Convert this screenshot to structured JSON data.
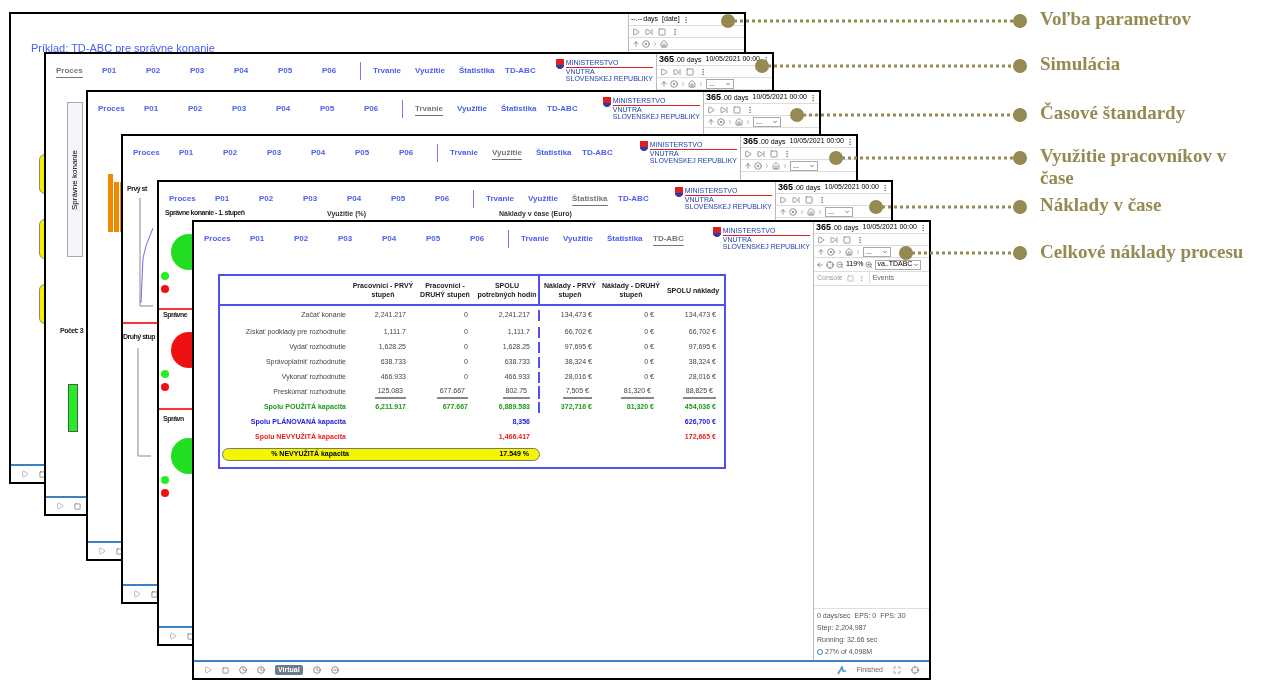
{
  "windows": [
    {
      "kind": "title",
      "title": "Príklad: TD-ABC pre správne konanie",
      "panel": {
        "time_value": "--.--",
        "time_unit": "days",
        "date": "[date]"
      },
      "content": [
        {
          "kind": "blob"
        },
        {
          "kind": "blob"
        },
        {
          "kind": "blob"
        }
      ]
    },
    {
      "kind": "nav",
      "nav_left": [
        {
          "label": "Proces",
          "selected": true
        },
        {
          "label": "P01",
          "selected": false
        },
        {
          "label": "P02",
          "selected": false
        },
        {
          "label": "P03",
          "selected": false
        },
        {
          "label": "P04",
          "selected": false
        },
        {
          "label": "P05",
          "selected": false
        },
        {
          "label": "P06",
          "selected": false
        }
      ],
      "nav_right": [
        {
          "label": "Trvanie",
          "selected": false
        },
        {
          "label": "Využitie",
          "selected": false
        },
        {
          "label": "Štatistika",
          "selected": false
        },
        {
          "label": "TD-ABC",
          "selected": false
        }
      ],
      "logo": [
        "MINISTERSTVO",
        "VNÚTRA",
        "SLOVENSKEJ REPUBLIKY"
      ],
      "panel": {
        "time_value": "365",
        "time_unit": ".00 days",
        "date": "10/05/2021 00:00",
        "select": "..."
      },
      "content": [
        {
          "kind": "vlabel",
          "text": "Správne konanie"
        },
        {
          "kind": "text",
          "text": "Počet: 3"
        },
        {
          "kind": "greenbar"
        }
      ]
    },
    {
      "kind": "nav",
      "nav_left": [
        {
          "label": "Proces",
          "selected": false
        },
        {
          "label": "P01",
          "selected": false
        },
        {
          "label": "P02",
          "selected": false
        },
        {
          "label": "P03",
          "selected": false
        },
        {
          "label": "P04",
          "selected": false
        },
        {
          "label": "P05",
          "selected": false
        },
        {
          "label": "P06",
          "selected": false
        }
      ],
      "nav_right": [
        {
          "label": "Trvanie",
          "selected": true
        },
        {
          "label": "Využitie",
          "selected": false
        },
        {
          "label": "Štatistika",
          "selected": false
        },
        {
          "label": "TD-ABC",
          "selected": false
        }
      ],
      "logo": [
        "MINISTERSTVO",
        "VNÚTRA",
        "SLOVENSKEJ REPUBLIKY"
      ],
      "panel": {
        "time_value": "365",
        "time_unit": ".00 days",
        "date": "10/05/2021 00:00",
        "select": "..."
      },
      "content": [
        {
          "kind": "bars"
        }
      ]
    },
    {
      "kind": "nav",
      "nav_left": [
        {
          "label": "Proces",
          "selected": false
        },
        {
          "label": "P01",
          "selected": false
        },
        {
          "label": "P02",
          "selected": false
        },
        {
          "label": "P03",
          "selected": false
        },
        {
          "label": "P04",
          "selected": false
        },
        {
          "label": "P05",
          "selected": false
        },
        {
          "label": "P06",
          "selected": false
        }
      ],
      "nav_right": [
        {
          "label": "Trvanie",
          "selected": false
        },
        {
          "label": "Využitie",
          "selected": true
        },
        {
          "label": "Štatistika",
          "selected": false
        },
        {
          "label": "TD-ABC",
          "selected": false
        }
      ],
      "logo": [
        "MINISTERSTVO",
        "VNÚTRA",
        "SLOVENSKEJ REPUBLIKY"
      ],
      "panel": {
        "time_value": "365",
        "time_unit": ".00 days",
        "date": "10/05/2021 00:00",
        "select": "..."
      },
      "content": [
        {
          "kind": "text",
          "text": "Prvý st"
        },
        {
          "kind": "line"
        },
        {
          "kind": "rule"
        },
        {
          "kind": "text",
          "text": "Druhý stup"
        },
        {
          "kind": "axes"
        }
      ]
    },
    {
      "kind": "nav",
      "nav_left": [
        {
          "label": "Proces",
          "selected": false
        },
        {
          "label": "P01",
          "selected": false
        },
        {
          "label": "P02",
          "selected": false
        },
        {
          "label": "P03",
          "selected": false
        },
        {
          "label": "P04",
          "selected": false
        },
        {
          "label": "P05",
          "selected": false
        },
        {
          "label": "P06",
          "selected": false
        }
      ],
      "nav_right": [
        {
          "label": "Trvanie",
          "selected": false
        },
        {
          "label": "Využitie",
          "selected": false
        },
        {
          "label": "Štatistika",
          "selected": true
        },
        {
          "label": "TD-ABC",
          "selected": false
        }
      ],
      "logo": [
        "MINISTERSTVO",
        "VNÚTRA",
        "SLOVENSKEJ REPUBLIKY"
      ],
      "panel": {
        "time_value": "365",
        "time_unit": ".00 days",
        "date": "10/05/2021 00:00",
        "select": "..."
      },
      "content": [
        {
          "kind": "text",
          "text": "Správne konanie - 1. stupeň"
        },
        {
          "kind": "small",
          "text": "Využitie (%)"
        },
        {
          "kind": "small",
          "text": "Náklady v čase (Euro)"
        },
        {
          "kind": "pie",
          "color": "#22dd22"
        },
        {
          "kind": "rule"
        },
        {
          "kind": "text",
          "text": "Správne"
        },
        {
          "kind": "pie",
          "color": "#ee1111"
        },
        {
          "kind": "rule"
        },
        {
          "kind": "text",
          "text": "Správn"
        },
        {
          "kind": "pie",
          "color": "#22dd22"
        }
      ]
    },
    {
      "kind": "front",
      "nav_left": [
        {
          "label": "Proces",
          "selected": false
        },
        {
          "label": "P01",
          "selected": false
        },
        {
          "label": "P02",
          "selected": false
        },
        {
          "label": "P03",
          "selected": false
        },
        {
          "label": "P04",
          "selected": false
        },
        {
          "label": "P05",
          "selected": false
        },
        {
          "label": "P06",
          "selected": false
        }
      ],
      "nav_right": [
        {
          "label": "Trvanie",
          "selected": false
        },
        {
          "label": "Využitie",
          "selected": false
        },
        {
          "label": "Štatistika",
          "selected": false
        },
        {
          "label": "TD-ABC",
          "selected": true
        }
      ],
      "logo": [
        "MINISTERSTVO",
        "VNÚTRA",
        "SLOVENSKEJ REPUBLIKY"
      ],
      "panel": {
        "time_value": "365",
        "time_unit": ".00 days",
        "date": "10/05/2021 00:00",
        "select": "...",
        "zoom": "119%",
        "view": "va..TDABC",
        "tabs": [
          "Console",
          "Events"
        ],
        "stats": [
          "0 days/sec",
          "EPS: 0",
          "FPS: 30",
          "Step: 2,204,987"
        ],
        "running": "Running: 32.66 sec",
        "memory": "27% of 4,098M"
      },
      "toolbar": {
        "mode": "Virtual",
        "status": "Finished"
      },
      "table": {
        "columns": [
          "Pracovníci - PRVÝ stupeň",
          "Pracovníci - DRUHÝ stupeň",
          "SPOLU potrebných hodín",
          "Náklady - PRVÝ stupeň",
          "Náklady - DRUHÝ stupeň",
          "SPOLU náklady"
        ],
        "rows": [
          {
            "kind": "item",
            "label": "Začať konanie",
            "values": [
              "2,241.217",
              "0",
              "2,241.217",
              "134,473 €",
              "0 €",
              "134,473 €"
            ]
          },
          {
            "kind": "item",
            "label": "Získať podklady pre rozhodnutie",
            "values": [
              "1,111.7",
              "0",
              "1,111.7",
              "66,702 €",
              "0 €",
              "66,702 €"
            ]
          },
          {
            "kind": "item",
            "label": "Vydať rozhodnutie",
            "values": [
              "1,628.25",
              "0",
              "1,628.25",
              "97,695 €",
              "0 €",
              "97,695 €"
            ]
          },
          {
            "kind": "item",
            "label": "Správoplatniť rozhodnutie",
            "values": [
              "638.733",
              "0",
              "638.733",
              "38,324 €",
              "0 €",
              "38,324 €"
            ]
          },
          {
            "kind": "item",
            "label": "Vykonať rozhodnutie",
            "values": [
              "466.933",
              "0",
              "466.933",
              "28,016 €",
              "0 €",
              "28,016 €"
            ]
          },
          {
            "kind": "last",
            "label": "Preskúmať rozhodnutie",
            "values": [
              "125.083",
              "677.667",
              "802.75",
              "7,505 €",
              "81,320 €",
              "88,825 €"
            ]
          },
          {
            "kind": "used",
            "label": "Spolu POUŽITÁ kapacita",
            "values": [
              "6,211.917",
              "677.667",
              "6,889.583",
              "372,716 €",
              "81,320 €",
              "454,036 €"
            ]
          },
          {
            "kind": "planned",
            "label": "Spolu PLÁNOVANÁ kapacita",
            "total_hours": "8,356",
            "total_cost": "626,700 €"
          },
          {
            "kind": "unused",
            "label": "Spolu NEVYUŽITÁ kapacita",
            "total_hours": "1,466.417",
            "total_cost": "172,665 €"
          },
          {
            "kind": "percent",
            "label": "% NEVYUŽITÁ kapacita",
            "total_hours": "17.549 %"
          }
        ]
      }
    }
  ],
  "callouts": [
    "Voľba parametrov",
    "Simulácia",
    "Časové štandardy",
    "Využitie pracovníkov v čase",
    "Náklady v čase",
    "Celkové náklady procesu"
  ]
}
